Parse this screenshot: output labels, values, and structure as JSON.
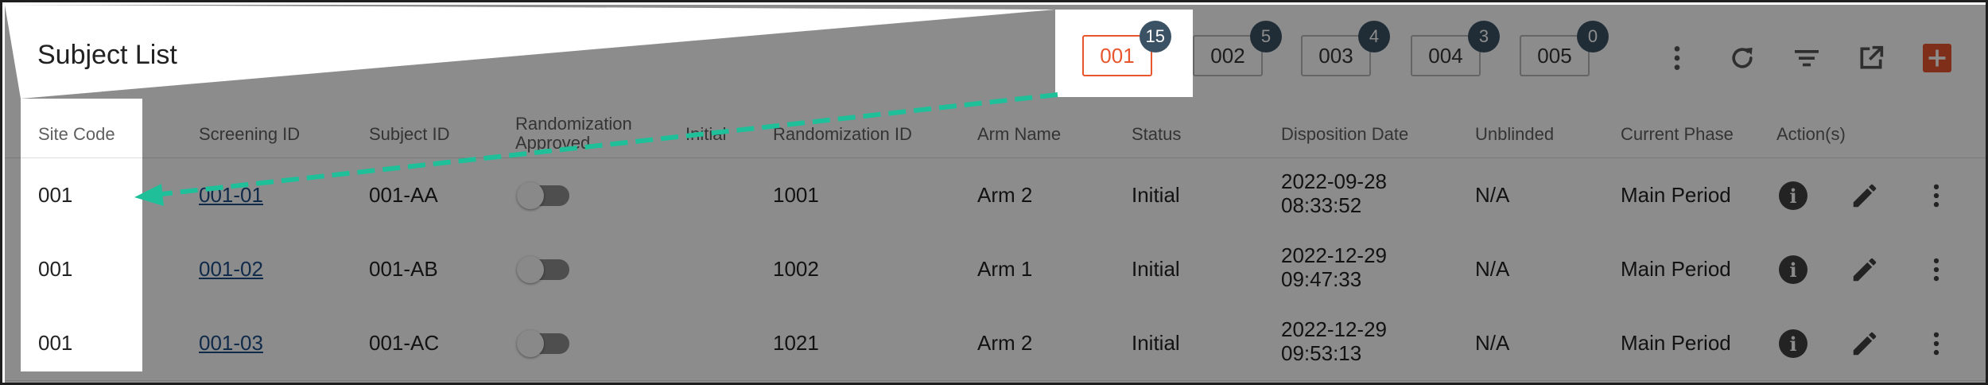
{
  "header": {
    "title": "Subject List"
  },
  "site_tabs": [
    {
      "label": "001",
      "count": "15",
      "active": true
    },
    {
      "label": "002",
      "count": "5",
      "active": false
    },
    {
      "label": "003",
      "count": "4",
      "active": false
    },
    {
      "label": "004",
      "count": "3",
      "active": false
    },
    {
      "label": "005",
      "count": "0",
      "active": false
    }
  ],
  "toolbar_icons": [
    "more-vert-icon",
    "refresh-icon",
    "filter-icon",
    "open-in-new-icon",
    "add-icon"
  ],
  "columns": {
    "site_code": "Site Code",
    "screening_id": "Screening ID",
    "subject_id": "Subject ID",
    "randomization_approved": "Randomization Approved",
    "initial": "Initial",
    "randomization_id": "Randomization ID",
    "arm_name": "Arm Name",
    "status": "Status",
    "disposition_date": "Disposition Date",
    "unblinded": "Unblinded",
    "current_phase": "Current Phase",
    "actions": "Action(s)"
  },
  "rows": [
    {
      "site_code": "001",
      "screening_id": "001-01",
      "subject_id": "001-AA",
      "randomization_approved": false,
      "initial": "",
      "randomization_id": "1001",
      "arm_name": "Arm 2",
      "status": "Initial",
      "disposition_date": "2022-09-28",
      "disposition_time": "08:33:52",
      "unblinded": "N/A",
      "current_phase": "Main Period"
    },
    {
      "site_code": "001",
      "screening_id": "001-02",
      "subject_id": "001-AB",
      "randomization_approved": false,
      "initial": "",
      "randomization_id": "1002",
      "arm_name": "Arm 1",
      "status": "Initial",
      "disposition_date": "2022-12-29",
      "disposition_time": "09:47:33",
      "unblinded": "N/A",
      "current_phase": "Main Period"
    },
    {
      "site_code": "001",
      "screening_id": "001-03",
      "subject_id": "001-AC",
      "randomization_approved": false,
      "initial": "",
      "randomization_id": "1021",
      "arm_name": "Arm 2",
      "status": "Initial",
      "disposition_date": "2022-12-29",
      "disposition_time": "09:53:13",
      "unblinded": "N/A",
      "current_phase": "Main Period"
    }
  ],
  "row_action_icons": [
    "info-icon",
    "edit-icon",
    "more-vert-icon"
  ],
  "colors": {
    "accent": "#e8562e",
    "badge": "#3b5265",
    "link": "#1e4d88",
    "annotation_arrow": "#1fbf9a"
  }
}
